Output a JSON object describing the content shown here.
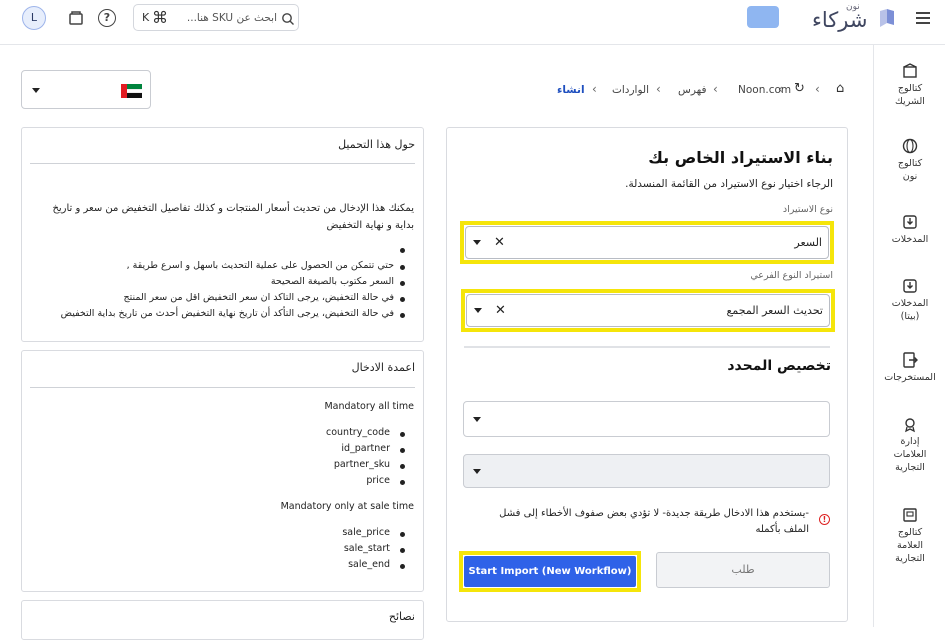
{
  "topbar": {
    "logo_top": "نون",
    "logo_main": "شركاء",
    "search_placeholder": "ابحث عن SKU هنا...",
    "shortcut_cmd": "⌘",
    "shortcut_key": "K",
    "avatar_letter": "L"
  },
  "sidebar": {
    "items": [
      {
        "label": "كتالوج الشريك"
      },
      {
        "label": "كتالوج نون"
      },
      {
        "label": "المدخلات"
      },
      {
        "label": "المدخلات (بيتا)"
      },
      {
        "label": "المستخرجات"
      },
      {
        "label": "إدارة العلامات التجارية"
      },
      {
        "label": "كتالوج العلامة التجارية"
      }
    ]
  },
  "breadcrumb": {
    "home": "⌂",
    "noon": "Noon.com",
    "index": "فهرس",
    "imports": "الواردات",
    "current": "انشاء"
  },
  "country": {
    "selected": "UAE"
  },
  "form": {
    "title": "بناء الاستيراد الخاص بك",
    "subtitle": "الرجاء اختيار نوع الاستيراد من القائمة المنسدلة.",
    "import_type_label": "نوع الاستيراد",
    "import_type_value": "السعر",
    "sub_type_label": "استيراد النوع الفرعي",
    "sub_type_value": "تحديث السعر المجمع",
    "customize_title": "تخصيص المحدد",
    "warning": "-يستخدم هذا الادخال طريقة جديدة- لا تؤدي بعض صفوف الأخطاء إلى فشل الملف بأكمله",
    "request_button": "طلب",
    "start_button": "Start Import (New Workflow)"
  },
  "about": {
    "title": "حول هذا التحميل",
    "intro": "يمكنك هذا الإدخال من تحديث أسعار المنتجات و كذلك تفاصيل التخفيض من سعر و تاريخ بداية و نهاية التخفيض",
    "bullets": [
      "",
      "حتي تتمكن من الحصول على عملية التحديث باسهل و اسرع طريقة ,",
      "السعر مكتوب بالصيغة الصحيحة",
      "في حالة التخفيض، يرجى التاكد ان سعر التخفيض اقل من سعر المنتج",
      "في حالة التخفيض، يرجى التأكد أن تاريخ نهاية التخفيض أحدث من تاريخ بداية التخفيض"
    ]
  },
  "columns": {
    "title": "اعمدة الادخال",
    "mandatory_all": "Mandatory all time",
    "all_fields": [
      "country_code",
      "id_partner",
      "partner_sku",
      "price"
    ],
    "mandatory_sale": "Mandatory only at sale time",
    "sale_fields": [
      "sale_price",
      "sale_start",
      "sale_end"
    ]
  },
  "tips": {
    "title": "نصائح"
  },
  "colors": {
    "accent": "#2f62e8",
    "highlight": "#f5e50a",
    "current_crumb": "#1f4fbf"
  }
}
